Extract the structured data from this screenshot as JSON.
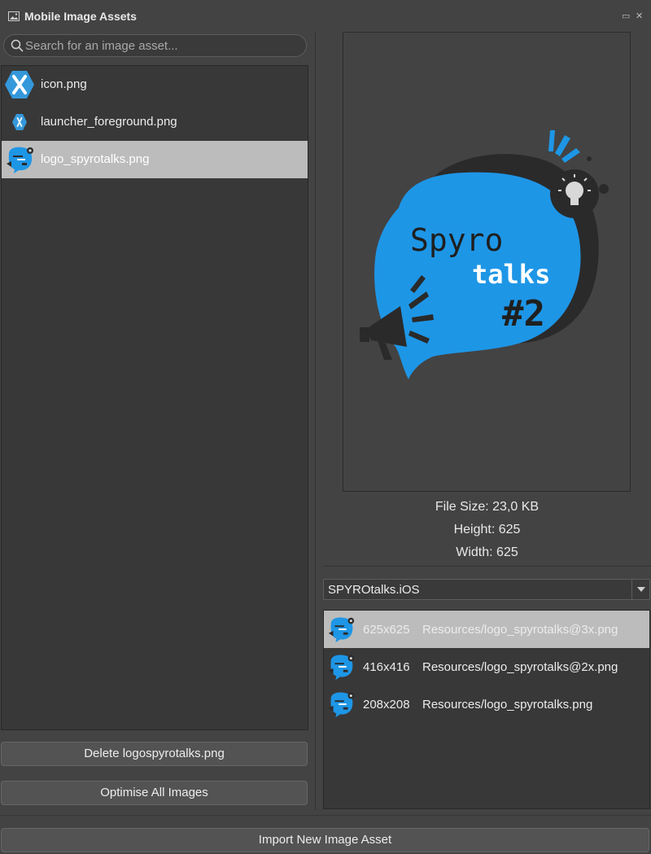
{
  "window": {
    "title": "Mobile Image Assets",
    "restore_glyph": "▭",
    "close_glyph": "✕"
  },
  "search": {
    "placeholder": "Search for an image asset..."
  },
  "assets": [
    {
      "name": "icon.png",
      "thumb": "xamarin-icon",
      "selected": false
    },
    {
      "name": "launcher_foreground.png",
      "thumb": "xamarin-icon",
      "selected": false
    },
    {
      "name": "logo_spyrotalks.png",
      "thumb": "spyrotalks-logo",
      "selected": true
    }
  ],
  "buttons": {
    "delete_label": "Delete logospyrotalks.png",
    "optimise_label": "Optimise All Images",
    "import_label": "Import New Image Asset"
  },
  "preview": {
    "logo": {
      "line1": "Spyro",
      "line2": "talks",
      "line3": "#2"
    }
  },
  "info": {
    "file_size": "File Size: 23,0 KB",
    "height": "Height: 625",
    "width": "Width:  625"
  },
  "project": {
    "selected": "SPYROtalks.iOS"
  },
  "resolutions": [
    {
      "size": "625x625",
      "path": "Resources/logo_spyrotalks@3x.png",
      "selected": true
    },
    {
      "size": "416x416",
      "path": "Resources/logo_spyrotalks@2x.png",
      "selected": false
    },
    {
      "size": "208x208",
      "path": "Resources/logo_spyrotalks.png",
      "selected": false
    }
  ],
  "colors": {
    "background": "#434343",
    "selection": "#bcbcbc",
    "logo_blue": "#1e96e6",
    "logo_dark": "#2a2a2a",
    "xamarin_blue": "#3498db"
  }
}
